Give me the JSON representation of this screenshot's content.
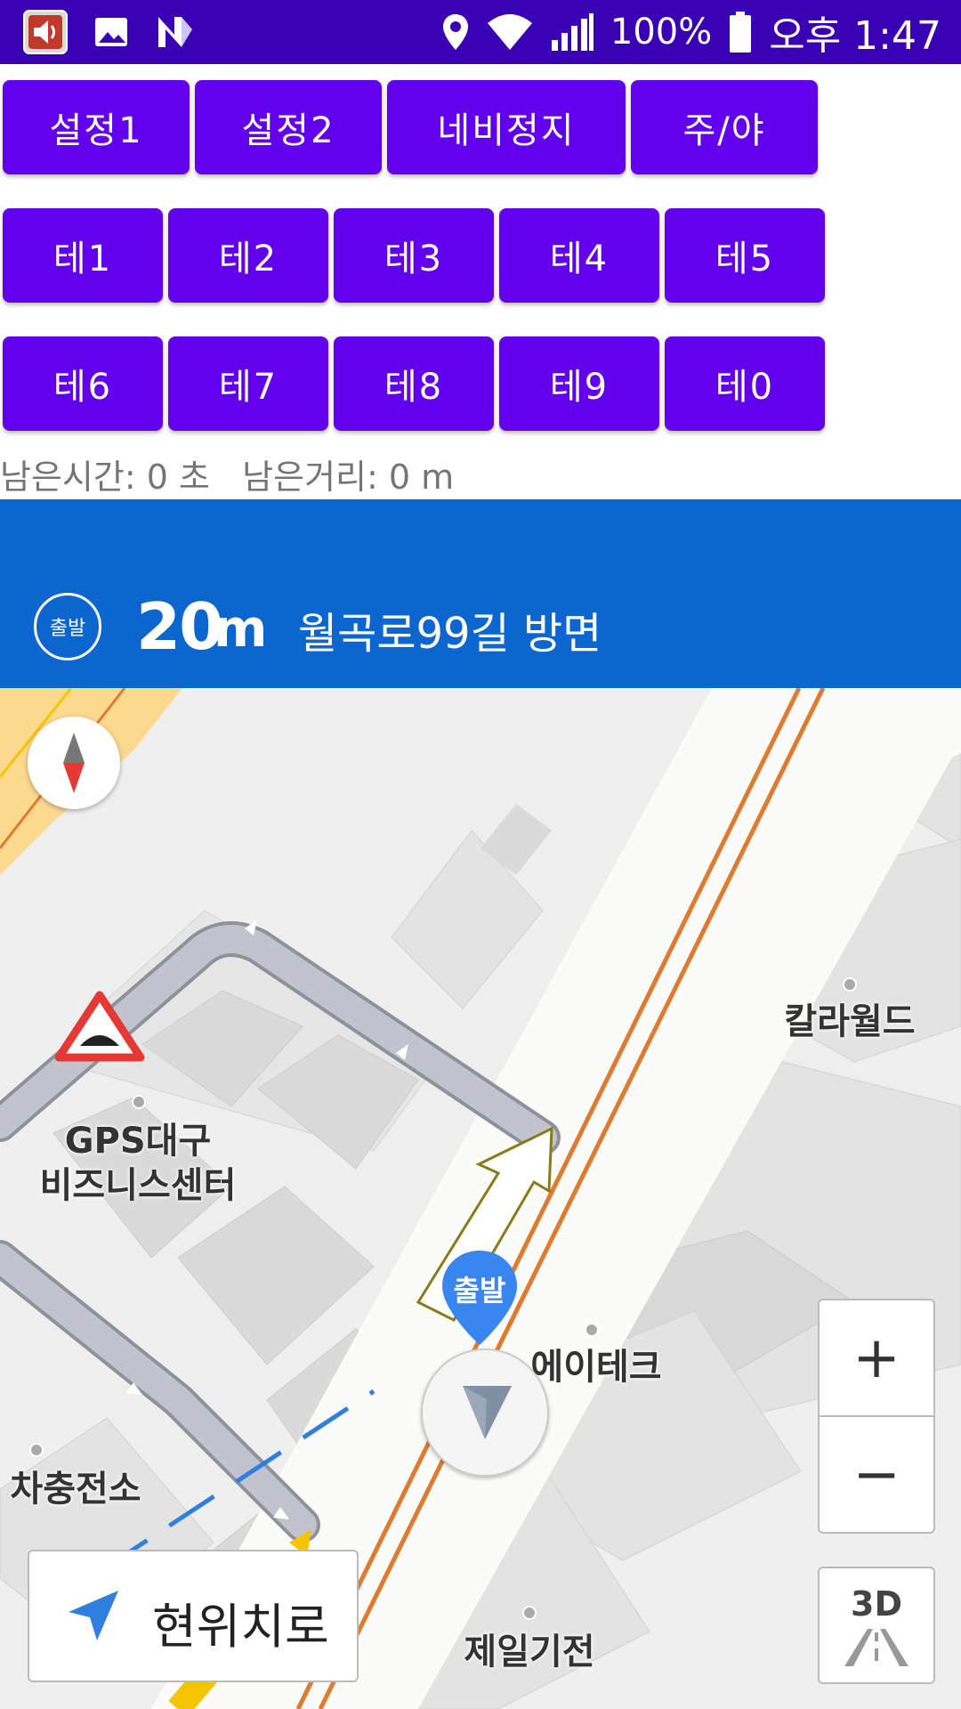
{
  "status_bar": {
    "icons_left": [
      "volume-app-icon",
      "image-icon",
      "n-icon"
    ],
    "icons_right": [
      "location-icon",
      "wifi-icon",
      "signal-icon",
      "battery-icon"
    ],
    "battery": "100%",
    "time": "오후 1:47"
  },
  "buttons_row1": [
    "설정1",
    "설정2",
    "네비정지",
    "주/야"
  ],
  "buttons_row2": [
    "테1",
    "테2",
    "테3",
    "테4",
    "테5"
  ],
  "buttons_row3": [
    "테6",
    "테7",
    "테8",
    "테9",
    "테0"
  ],
  "info": {
    "line": "남은시간: 0 초   남은거리: 0 m"
  },
  "guidance": {
    "badge": "출발",
    "distance_value": "20",
    "distance_unit": "m",
    "direction": "월곡로99길 방면"
  },
  "map": {
    "pois": {
      "kalaworld": "칼라월드",
      "gps_line1": "GPS대구",
      "gps_line2": "비즈니스센터",
      "atech": "에이테크",
      "charging": "차충전소",
      "jeil": "제일기전"
    },
    "start_pin": "출발",
    "zoom_in": "+",
    "zoom_out": "−",
    "mode_3d": "3D",
    "current_location": "현위치로"
  },
  "colors": {
    "status_bar": "#3a00b4",
    "button": "#6200ee",
    "guidance_banner": "#0d66d0",
    "route": "#b8bcc6",
    "road_orange": "#e07a30"
  }
}
